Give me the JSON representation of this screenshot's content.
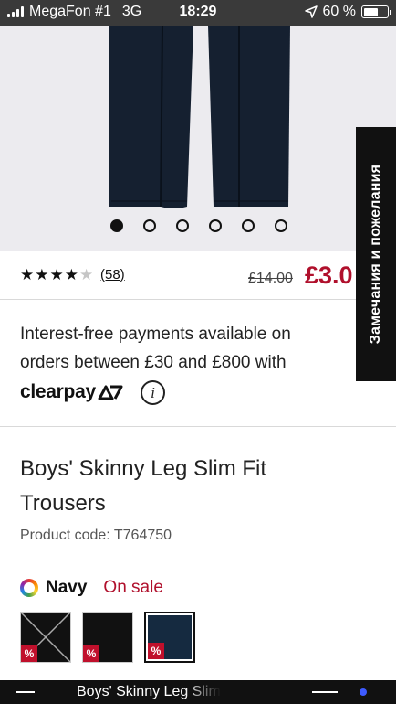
{
  "status_bar": {
    "carrier": "MegaFon #1",
    "network": "3G",
    "time": "18:29",
    "battery_text": "60 %",
    "battery_level": 0.6
  },
  "gallery": {
    "dot_count": 6,
    "active_index": 0,
    "trouser_color": "#152030"
  },
  "rating": {
    "stars": 4,
    "max_stars": 5,
    "review_count": "(58)"
  },
  "price": {
    "old": "£14.00",
    "new": "£3.0"
  },
  "feedback_tab": {
    "label": "Замечания и пожелания"
  },
  "clearpay": {
    "text": "Interest-free payments available on orders between £30 and £800 with",
    "logo_text": "clearpay",
    "info_icon": "i"
  },
  "product": {
    "title": "Boys' Skinny Leg Slim Fit Trousers",
    "code_label": "Product code: T764750"
  },
  "color": {
    "name": "Navy",
    "status": "On sale"
  },
  "swatches": [
    {
      "name": "unavailable",
      "color": "#111111",
      "badge": "%"
    },
    {
      "name": "black",
      "color": "#111111",
      "badge": "%"
    },
    {
      "name": "navy",
      "color": "#152a40",
      "badge": "%"
    }
  ],
  "bottom_bar": {
    "label": "Boys' Skinny Leg Slim"
  },
  "colors": {
    "accent_red": "#b0102c",
    "hero_bg": "#ecebef"
  }
}
